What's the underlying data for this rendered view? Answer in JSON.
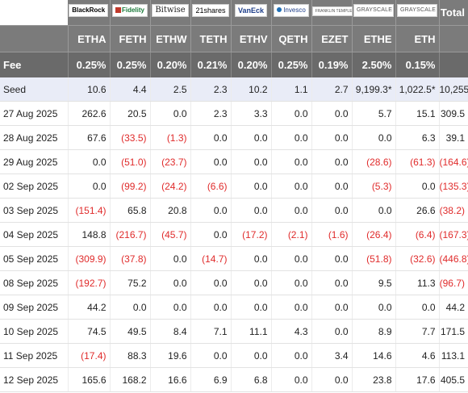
{
  "header": {
    "total_label": "Total",
    "fee_label": "Fee"
  },
  "funds": [
    {
      "logo": "BlackRock",
      "ticker": "ETHA",
      "fee": "0.25%"
    },
    {
      "logo": "Fidelity",
      "ticker": "FETH",
      "fee": "0.25%"
    },
    {
      "logo": "Bitwise",
      "ticker": "ETHW",
      "fee": "0.20%"
    },
    {
      "logo": "21shares",
      "ticker": "TETH",
      "fee": "0.21%"
    },
    {
      "logo": "VanEck",
      "ticker": "ETHV",
      "fee": "0.20%"
    },
    {
      "logo": "Invesco",
      "ticker": "QETH",
      "fee": "0.25%"
    },
    {
      "logo": "FRANKLIN TEMPLETON",
      "ticker": "EZET",
      "fee": "0.19%"
    },
    {
      "logo": "GRAYSCALE",
      "ticker": "ETHE",
      "fee": "2.50%"
    },
    {
      "logo": "GRAYSCALE",
      "ticker": "ETH",
      "fee": "0.15%"
    }
  ],
  "rows": [
    {
      "label": "Seed",
      "cells": [
        "10.6",
        "4.4",
        "2.5",
        "2.3",
        "10.2",
        "1.1",
        "2.7",
        "9,199.3*",
        "1,022.5*",
        "10,255"
      ]
    },
    {
      "label": "27 Aug 2025",
      "cells": [
        "262.6",
        "20.5",
        "0.0",
        "2.3",
        "3.3",
        "0.0",
        "0.0",
        "5.7",
        "15.1",
        "309.5"
      ]
    },
    {
      "label": "28 Aug 2025",
      "cells": [
        "67.6",
        "(33.5)",
        "(1.3)",
        "0.0",
        "0.0",
        "0.0",
        "0.0",
        "0.0",
        "6.3",
        "39.1"
      ]
    },
    {
      "label": "29 Aug 2025",
      "cells": [
        "0.0",
        "(51.0)",
        "(23.7)",
        "0.0",
        "0.0",
        "0.0",
        "0.0",
        "(28.6)",
        "(61.3)",
        "(164.6)"
      ]
    },
    {
      "label": "02 Sep 2025",
      "cells": [
        "0.0",
        "(99.2)",
        "(24.2)",
        "(6.6)",
        "0.0",
        "0.0",
        "0.0",
        "(5.3)",
        "0.0",
        "(135.3)"
      ]
    },
    {
      "label": "03 Sep 2025",
      "cells": [
        "(151.4)",
        "65.8",
        "20.8",
        "0.0",
        "0.0",
        "0.0",
        "0.0",
        "0.0",
        "26.6",
        "(38.2)"
      ]
    },
    {
      "label": "04 Sep 2025",
      "cells": [
        "148.8",
        "(216.7)",
        "(45.7)",
        "0.0",
        "(17.2)",
        "(2.1)",
        "(1.6)",
        "(26.4)",
        "(6.4)",
        "(167.3)"
      ]
    },
    {
      "label": "05 Sep 2025",
      "cells": [
        "(309.9)",
        "(37.8)",
        "0.0",
        "(14.7)",
        "0.0",
        "0.0",
        "0.0",
        "(51.8)",
        "(32.6)",
        "(446.8)"
      ]
    },
    {
      "label": "08 Sep 2025",
      "cells": [
        "(192.7)",
        "75.2",
        "0.0",
        "0.0",
        "0.0",
        "0.0",
        "0.0",
        "9.5",
        "11.3",
        "(96.7)"
      ]
    },
    {
      "label": "09 Sep 2025",
      "cells": [
        "44.2",
        "0.0",
        "0.0",
        "0.0",
        "0.0",
        "0.0",
        "0.0",
        "0.0",
        "0.0",
        "44.2"
      ]
    },
    {
      "label": "10 Sep 2025",
      "cells": [
        "74.5",
        "49.5",
        "8.4",
        "7.1",
        "11.1",
        "4.3",
        "0.0",
        "8.9",
        "7.7",
        "171.5"
      ]
    },
    {
      "label": "11 Sep 2025",
      "cells": [
        "(17.4)",
        "88.3",
        "19.6",
        "0.0",
        "0.0",
        "0.0",
        "3.4",
        "14.6",
        "4.6",
        "113.1"
      ]
    },
    {
      "label": "12 Sep 2025",
      "cells": [
        "165.6",
        "168.2",
        "16.6",
        "6.9",
        "6.8",
        "0.0",
        "0.0",
        "23.8",
        "17.6",
        "405.5"
      ]
    }
  ],
  "colors": {
    "header_bg": "#7b7b7b",
    "fee_bg": "#6a6a6a",
    "seed_bg": "#e9ecf7",
    "negative": "#e02b2b"
  }
}
